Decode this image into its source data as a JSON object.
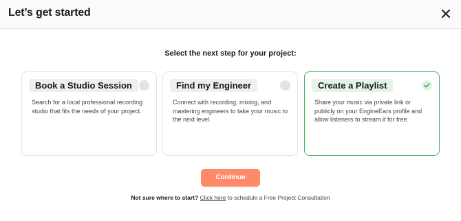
{
  "header": {
    "title": "Let’s get started",
    "close_icon": "close-icon"
  },
  "subtitle": "Select the next step for your project:",
  "cards": [
    {
      "title": "Book a Studio Session",
      "description": "Search for a local professional recording studio that fits the needs of your project.",
      "selected": false
    },
    {
      "title": "Find my Engineer",
      "description": "Connect with recording, mixing, and mastering engineers to take your music to the next level.",
      "selected": false
    },
    {
      "title": "Create a Playlist",
      "description": "Share your music via private link or publicly on your EngineEars profile and allow listeners to stream it for free.",
      "selected": true
    }
  ],
  "continue_label": "Continue",
  "footer": {
    "prompt": "Not sure where to start?",
    "link_text": "Click here",
    "suffix": " to schedule a Free Project Consultation"
  },
  "colors": {
    "accent": "#ff8a6a",
    "selected_border": "#49b267",
    "check": "#3aa85a"
  }
}
